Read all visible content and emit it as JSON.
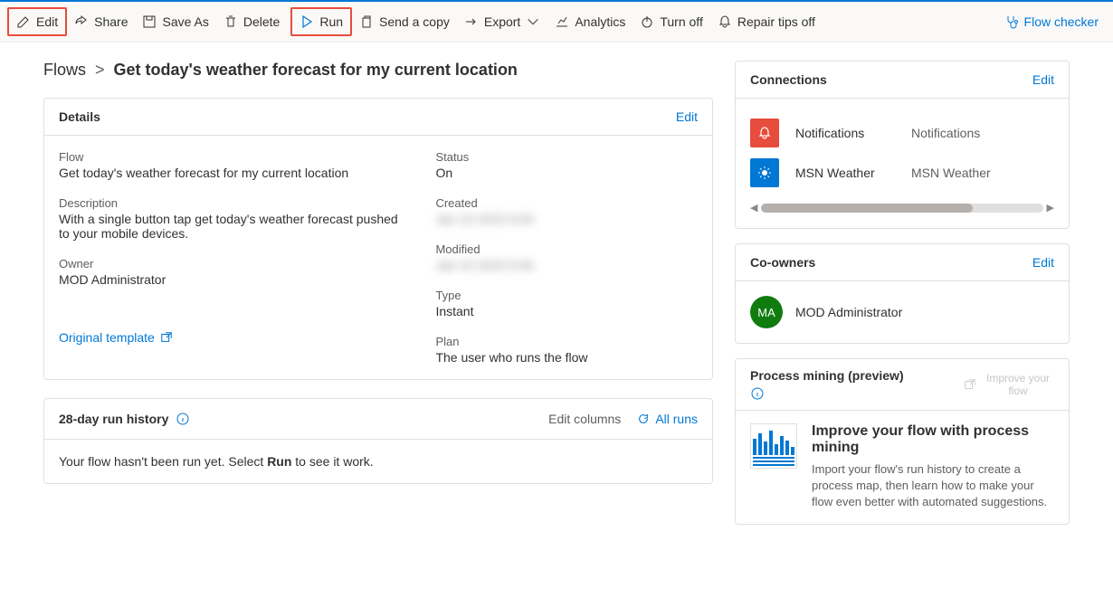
{
  "toolbar": {
    "edit": "Edit",
    "share": "Share",
    "save_as": "Save As",
    "delete": "Delete",
    "run": "Run",
    "send_copy": "Send a copy",
    "export": "Export",
    "analytics": "Analytics",
    "turn_off": "Turn off",
    "repair_tips": "Repair tips off",
    "flow_checker": "Flow checker"
  },
  "breadcrumb": {
    "root": "Flows",
    "current": "Get today's weather forecast for my current location"
  },
  "details": {
    "title": "Details",
    "edit": "Edit",
    "fields": {
      "flow_label": "Flow",
      "flow_value": "Get today's weather forecast for my current location",
      "desc_label": "Description",
      "desc_value": "With a single button tap get today's weather forecast pushed to your mobile devices.",
      "owner_label": "Owner",
      "owner_value": "MOD Administrator",
      "status_label": "Status",
      "status_value": "On",
      "created_label": "Created",
      "created_value": "Jan 10 2023 9:00",
      "modified_label": "Modified",
      "modified_value": "Jan 10 2023 9:00",
      "type_label": "Type",
      "type_value": "Instant",
      "plan_label": "Plan",
      "plan_value": "The user who runs the flow"
    },
    "original_template": "Original template"
  },
  "run_history": {
    "title": "28-day run history",
    "edit_columns": "Edit columns",
    "all_runs": "All runs",
    "empty_prefix": "Your flow hasn't been run yet. Select ",
    "empty_bold": "Run",
    "empty_suffix": " to see it work."
  },
  "connections": {
    "title": "Connections",
    "edit": "Edit",
    "items": [
      {
        "name": "Notifications",
        "type": "Notifications"
      },
      {
        "name": "MSN Weather",
        "type": "MSN Weather"
      }
    ]
  },
  "coowners": {
    "title": "Co-owners",
    "edit": "Edit",
    "persona_initials": "MA",
    "persona_name": "MOD Administrator"
  },
  "process_mining": {
    "title": "Process mining (preview)",
    "improve_link": "Improve your flow",
    "heading": "Improve your flow with process mining",
    "desc": "Import your flow's run history to create a process map, then learn how to make your flow even better with automated suggestions."
  }
}
